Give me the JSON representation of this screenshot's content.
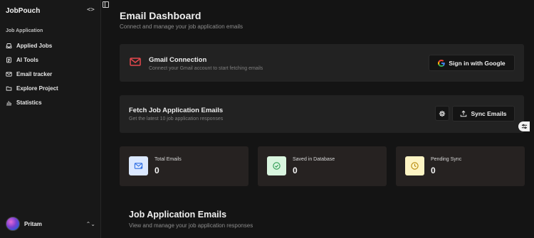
{
  "sidebar": {
    "brand": "JobPouch",
    "collapse_icon": "code-brackets-icon",
    "section_label": "Job Application",
    "items": [
      {
        "label": "Applied Jobs",
        "icon": "inbox-icon"
      },
      {
        "label": "AI Tools",
        "icon": "document-icon"
      },
      {
        "label": "Email tracker",
        "icon": "mail-icon"
      },
      {
        "label": "Explore Project",
        "icon": "folder-icon"
      },
      {
        "label": "Statistics",
        "icon": "bar-chart-icon"
      }
    ],
    "user": {
      "name": "Pritam",
      "chevron": "⌃⌄"
    }
  },
  "header": {
    "title": "Email Dashboard",
    "subtitle": "Connect and manage your job application emails"
  },
  "gmail": {
    "title": "Gmail Connection",
    "description": "Connect your Gmail account to start fetching emails",
    "button_label": "Sign in with Google",
    "accent": "#e5484d"
  },
  "fetch": {
    "title": "Fetch Job Application Emails",
    "description": "Get the latest 10 job application responses",
    "sync_label": "Sync Emails"
  },
  "stats": [
    {
      "label": "Total Emails",
      "value": "0",
      "icon": "mail-plus-icon",
      "color": "#2f6fe4"
    },
    {
      "label": "Saved in Database",
      "value": "0",
      "icon": "check-circle-icon",
      "color": "#2d9b52"
    },
    {
      "label": "Pending Sync",
      "value": "0",
      "icon": "clock-icon",
      "color": "#b88a0b"
    }
  ],
  "emails": {
    "title": "Job Application Emails",
    "subtitle": "View and manage your job application responses"
  }
}
